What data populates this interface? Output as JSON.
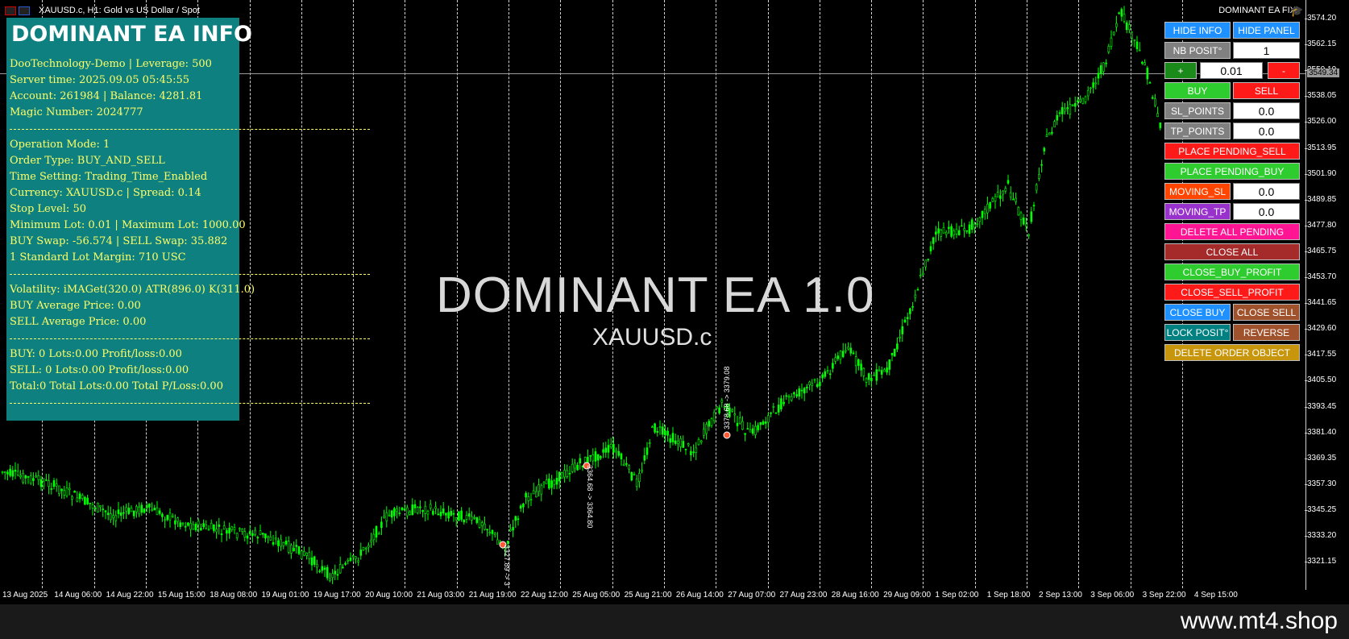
{
  "window": {
    "title": "XAUUSD.c, H1:  Gold vs US Dollar / Spot",
    "ea_label": "DOMINANT EA FIX"
  },
  "info": {
    "header": "DOMINANT EA INFO",
    "lines": [
      "DooTechnology-Demo | Leverage: 500",
      "Server time: 2025.09.05 05:45:55",
      "Account: 261984 | Balance: 4281.81",
      "Magic Number: 2024777",
      "Operation Mode:  1",
      "Order Type: BUY_AND_SELL",
      "Time Setting: Trading_Time_Enabled",
      "Currency: XAUUSD.c | Spread: 0.14",
      "Stop Level: 50",
      "Minimum Lot: 0.01 | Maximum Lot: 1000.00",
      "BUY Swap: -56.574 |  SELL Swap: 35.882",
      "1 Standard Lot Margin: 710 USC",
      "Volatility: iMAGet(320.0) ATR(896.0) K(311.0)",
      "BUY Average Price: 0.00",
      "SELL Average Price: 0.00",
      "BUY: 0 Lots:0.00 Profit/loss:0.00",
      "SELL: 0 Lots:0.00 Profit/loss:0.00",
      "Total:0 Total Lots:0.00 Total P/Loss:0.00"
    ]
  },
  "overlay": {
    "title": "DOMINANT EA 1.0",
    "symbol": "XAUUSD.c"
  },
  "panel": {
    "hide_info": "HIDE INFO",
    "hide_panel": "HIDE PANEL",
    "nb_posit_label": "NB POSIT°",
    "nb_posit_value": "1",
    "plus": "+",
    "lot_value": "0.01",
    "minus": "-",
    "buy": "BUY",
    "sell": "SELL",
    "sl_points_label": "SL_POINTS",
    "sl_points_value": "0.0",
    "tp_points_label": "TP_POINTS",
    "tp_points_value": "0.0",
    "place_pending_sell": "PLACE PENDING_SELL",
    "place_pending_buy": "PLACE PENDING_BUY",
    "moving_sl_label": "MOVING_SL",
    "moving_sl_value": "0.0",
    "moving_tp_label": "MOVING_TP",
    "moving_tp_value": "0.0",
    "delete_all_pending": "DELETE ALL PENDING",
    "close_all": "CLOSE ALL",
    "close_buy_profit": "CLOSE_BUY_PROFIT",
    "close_sell_profit": "CLOSE_SELL_PROFIT",
    "close_buy": "CLOSE BUY",
    "close_sell": "CLOSE SELL",
    "lock_posit": "LOCK POSIT°",
    "reverse": "REVERSE",
    "delete_order_object": "DELETE ORDER OBJECT",
    "colors": {
      "blue": "#1e90ff",
      "gray": "#808080",
      "green": "#2ecc2e",
      "dark_green": "#1a8a1a",
      "red": "#ff1a1a",
      "orange_red": "#ff4500",
      "purple": "#9932cc",
      "pink": "#ff1493",
      "brown": "#a52a2a",
      "sienna": "#a0522d",
      "teal": "#008080",
      "goldenrod": "#c8960c"
    }
  },
  "price_axis": {
    "current_price": "3549.34",
    "ticks": [
      "3574.20",
      "3562.15",
      "3550.10",
      "3538.05",
      "3526.00",
      "3513.95",
      "3501.90",
      "3489.85",
      "3477.80",
      "3465.75",
      "3453.70",
      "3441.65",
      "3429.60",
      "3417.55",
      "3405.50",
      "3393.45",
      "3381.40",
      "3369.35",
      "3357.30",
      "3345.25",
      "3333.20",
      "3321.15"
    ]
  },
  "time_axis": {
    "labels": [
      "13 Aug 2025",
      "14 Aug 06:00",
      "14 Aug 22:00",
      "15 Aug 15:00",
      "18 Aug 08:00",
      "19 Aug 01:00",
      "19 Aug 17:00",
      "20 Aug 10:00",
      "21 Aug 03:00",
      "21 Aug 19:00",
      "22 Aug 12:00",
      "25 Aug 05:00",
      "25 Aug 21:00",
      "26 Aug 14:00",
      "27 Aug 07:00",
      "27 Aug 23:00",
      "28 Aug 16:00",
      "29 Aug 09:00",
      "1 Sep 02:00",
      "1 Sep 18:00",
      "2 Sep 13:00",
      "3 Sep 06:00",
      "3 Sep 22:00",
      "4 Sep 15:00"
    ]
  },
  "trade_markers": {
    "m1": "3327.89 -> 3",
    "m2": "3364.68 -> 3364.80",
    "m3": "3378.68 -> 3379.08"
  },
  "footer": {
    "site": "www.mt4.shop"
  },
  "candle_color": "#00ff00"
}
